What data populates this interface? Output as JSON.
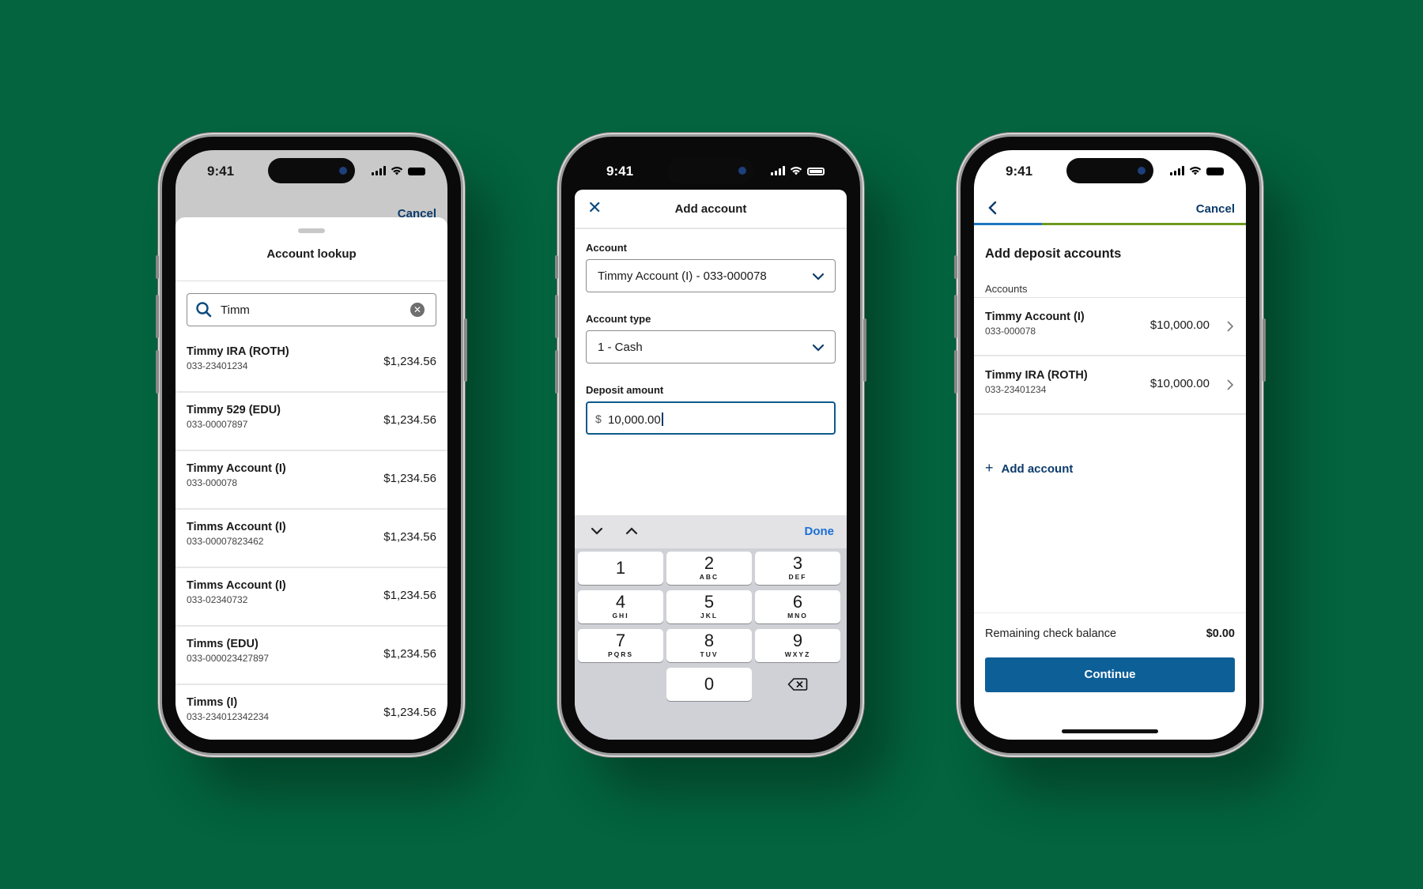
{
  "status_bar": {
    "time": "9:41"
  },
  "phone1": {
    "behind_cancel": "Cancel",
    "sheet_title": "Account lookup",
    "search": {
      "value": "Timm",
      "icon": "search-icon",
      "clear_icon": "clear-icon"
    },
    "results": [
      {
        "name": "Timmy IRA (ROTH)",
        "number": "033-23401234",
        "balance": "$1,234.56"
      },
      {
        "name": "Timmy 529 (EDU)",
        "number": "033-00007897",
        "balance": "$1,234.56"
      },
      {
        "name": "Timmy Account (I)",
        "number": "033-000078",
        "balance": "$1,234.56"
      },
      {
        "name": "Timms Account (I)",
        "number": "033-00007823462",
        "balance": "$1,234.56"
      },
      {
        "name": "Timms Account (I)",
        "number": "033-02340732",
        "balance": "$1,234.56"
      },
      {
        "name": "Timms (EDU)",
        "number": "033-000023427897",
        "balance": "$1,234.56"
      },
      {
        "name": "Timms (I)",
        "number": "033-234012342234",
        "balance": "$1,234.56"
      }
    ]
  },
  "phone2": {
    "title": "Add account",
    "close_icon": "close-icon",
    "account": {
      "label": "Account",
      "value": "Timmy Account (I) - 033-000078"
    },
    "account_type": {
      "label": "Account type",
      "value": "1 - Cash"
    },
    "deposit": {
      "label": "Deposit amount",
      "currency": "$",
      "value": "10,000.00"
    },
    "toolbar": {
      "done": "Done"
    },
    "keys": [
      {
        "digit": "1",
        "letters": ""
      },
      {
        "digit": "2",
        "letters": "ABC"
      },
      {
        "digit": "3",
        "letters": "DEF"
      },
      {
        "digit": "4",
        "letters": "GHI"
      },
      {
        "digit": "5",
        "letters": "JKL"
      },
      {
        "digit": "6",
        "letters": "MNO"
      },
      {
        "digit": "7",
        "letters": "PQRS"
      },
      {
        "digit": "8",
        "letters": "TUV"
      },
      {
        "digit": "9",
        "letters": "WXYZ"
      },
      {
        "digit": "0",
        "letters": ""
      }
    ]
  },
  "phone3": {
    "cancel": "Cancel",
    "progress_fraction": 0.25,
    "colors": {
      "progress_done": "#1f78c2",
      "progress_rest": "#6f9a1e",
      "primary": "#0d5f98"
    },
    "title": "Add deposit accounts",
    "accounts_label": "Accounts",
    "accounts": [
      {
        "name": "Timmy Account (I)",
        "number": "033-000078",
        "amount": "$10,000.00"
      },
      {
        "name": "Timmy IRA (ROTH)",
        "number": "033-23401234",
        "amount": "$10,000.00"
      }
    ],
    "add_account": "Add account",
    "remaining_label": "Remaining check balance",
    "remaining_value": "$0.00",
    "continue": "Continue"
  }
}
